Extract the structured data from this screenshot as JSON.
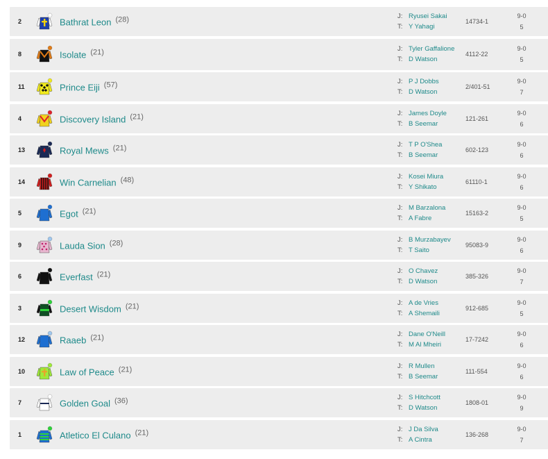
{
  "runners": [
    {
      "num": "2",
      "name": "Bathrat Leon",
      "age": "(28)",
      "jockey": "Ryusei Sakai",
      "trainer": "Y Yahagi",
      "form": "14734-1",
      "weight": "9-0",
      "draw": "5",
      "colors": {
        "body": "#1e3fae",
        "sleeve": "#ffffff",
        "cap": "#ffffff",
        "pattern": "cross",
        "patcol": "#f5d20b"
      }
    },
    {
      "num": "8",
      "name": "Isolate",
      "age": "(21)",
      "jockey": "Tyler Gaffalione",
      "trainer": "D Watson",
      "form": "4112-22",
      "weight": "9-0",
      "draw": "5",
      "colors": {
        "body": "#111111",
        "sleeve": "#e07b16",
        "cap": "#e07b16",
        "pattern": "chev",
        "patcol": "#e07b16"
      }
    },
    {
      "num": "11",
      "name": "Prince Eiji",
      "age": "(57)",
      "jockey": "P J Dobbs",
      "trainer": "D Watson",
      "form": "2/401-51",
      "weight": "9-0",
      "draw": "7",
      "colors": {
        "body": "#f1ea1e",
        "sleeve": "#f1ea1e",
        "cap": "#f1ea1e",
        "pattern": "diamonds",
        "patcol": "#111111"
      }
    },
    {
      "num": "4",
      "name": "Discovery Island",
      "age": "(21)",
      "jockey": "James Doyle",
      "trainer": "B Seemar",
      "form": "121-261",
      "weight": "9-0",
      "draw": "6",
      "colors": {
        "body": "#f1d21e",
        "sleeve": "#f1d21e",
        "cap": "#e0202a",
        "pattern": "vee",
        "patcol": "#e0202a"
      }
    },
    {
      "num": "13",
      "name": "Royal Mews",
      "age": "(21)",
      "jockey": "T P O'Shea",
      "trainer": "B Seemar",
      "form": "602-123",
      "weight": "9-0",
      "draw": "6",
      "colors": {
        "body": "#1b2a55",
        "sleeve": "#1b2a55",
        "cap": "#1b2a55",
        "pattern": "leaf",
        "patcol": "#d11e1e"
      }
    },
    {
      "num": "14",
      "name": "Win Carnelian",
      "age": "(48)",
      "jockey": "Kosei Miura",
      "trainer": "Y Shikato",
      "form": "61110-1",
      "weight": "9-0",
      "draw": "6",
      "colors": {
        "body": "#d11e1e",
        "sleeve": "#d11e1e",
        "cap": "#d11e1e",
        "pattern": "stripes",
        "patcol": "#111111"
      }
    },
    {
      "num": "5",
      "name": "Egot",
      "age": "(21)",
      "jockey": "M Barzalona",
      "trainer": "A Fabre",
      "form": "15163-2",
      "weight": "9-0",
      "draw": "5",
      "colors": {
        "body": "#1e6fd1",
        "sleeve": "#1e6fd1",
        "cap": "#1e6fd1",
        "pattern": "none",
        "patcol": "#1e6fd1"
      }
    },
    {
      "num": "9",
      "name": "Lauda Sion",
      "age": "(28)",
      "jockey": "B Murzabayev",
      "trainer": "T Saito",
      "form": "95083-9",
      "weight": "9-0",
      "draw": "6",
      "colors": {
        "body": "#e7b7cf",
        "sleeve": "#e7b7cf",
        "cap": "#9fc7ee",
        "pattern": "spots",
        "patcol": "#c0206a"
      }
    },
    {
      "num": "6",
      "name": "Everfast",
      "age": "(21)",
      "jockey": "O Chavez",
      "trainer": "D Watson",
      "form": "385-326",
      "weight": "9-0",
      "draw": "7",
      "colors": {
        "body": "#111111",
        "sleeve": "#111111",
        "cap": "#111111",
        "pattern": "none",
        "patcol": "#111111"
      }
    },
    {
      "num": "3",
      "name": "Desert Wisdom",
      "age": "(21)",
      "jockey": "A de Vries",
      "trainer": "A Shemaili",
      "form": "912-685",
      "weight": "9-0",
      "draw": "5",
      "colors": {
        "body": "#0f4f24",
        "sleeve": "#111111",
        "cap": "#2ed33a",
        "pattern": "band",
        "patcol": "#2ed33a"
      }
    },
    {
      "num": "12",
      "name": "Raaeb",
      "age": "(21)",
      "jockey": "Dane O'Neill",
      "trainer": "M Al Mheiri",
      "form": "17-7242",
      "weight": "9-0",
      "draw": "6",
      "colors": {
        "body": "#1e6fd1",
        "sleeve": "#1e6fd1",
        "cap": "#9fc7ee",
        "pattern": "none",
        "patcol": "#ffffff"
      }
    },
    {
      "num": "10",
      "name": "Law of Peace",
      "age": "(21)",
      "jockey": "R Mullen",
      "trainer": "B Seemar",
      "form": "111-554",
      "weight": "9-0",
      "draw": "6",
      "colors": {
        "body": "#9fe93a",
        "sleeve": "#9fe93a",
        "cap": "#9fe93a",
        "pattern": "cross",
        "patcol": "#e7a62a"
      }
    },
    {
      "num": "7",
      "name": "Golden Goal",
      "age": "(36)",
      "jockey": "S Hitchcott",
      "trainer": "D Watson",
      "form": "1808-01",
      "weight": "9-0",
      "draw": "9",
      "colors": {
        "body": "#ffffff",
        "sleeve": "#ffffff",
        "cap": "#ffffff",
        "pattern": "hoop",
        "patcol": "#1b2a55"
      }
    },
    {
      "num": "1",
      "name": "Atletico El Culano",
      "age": "(21)",
      "jockey": "J Da Silva",
      "trainer": "A Cintra",
      "form": "136-268",
      "weight": "9-0",
      "draw": "7",
      "colors": {
        "body": "#1e6fd1",
        "sleeve": "#1e6fd1",
        "cap": "#2ed33a",
        "pattern": "hoops",
        "patcol": "#2ed33a"
      }
    }
  ],
  "labels": {
    "jockey": "J:",
    "trainer": "T:"
  }
}
